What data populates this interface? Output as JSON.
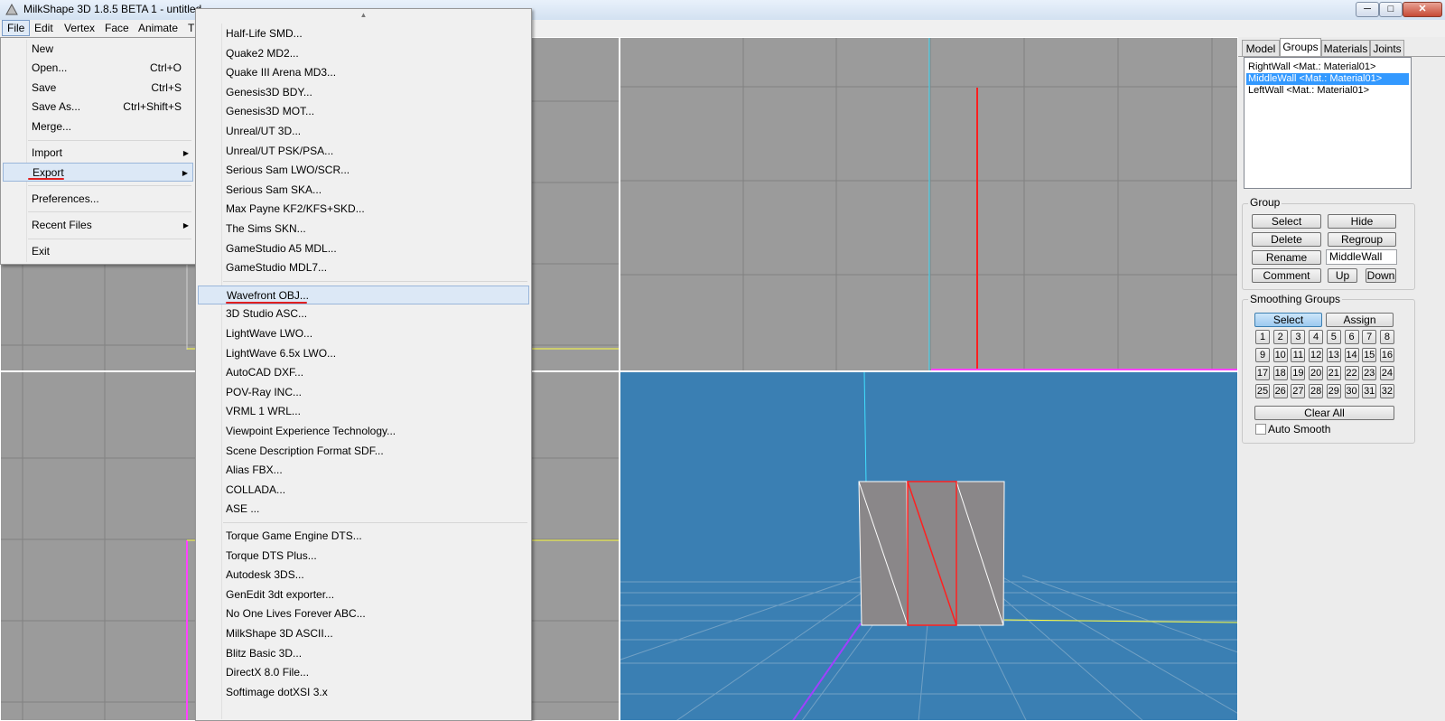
{
  "window": {
    "title": "MilkShape 3D 1.8.5 BETA 1 - untitled"
  },
  "window_controls": {
    "minimize": "─",
    "maximize": "□",
    "close": "✕"
  },
  "menubar": {
    "items": [
      "File",
      "Edit",
      "Vertex",
      "Face",
      "Animate",
      "T"
    ]
  },
  "file_menu": {
    "items": [
      {
        "label": "New",
        "shortcut": ""
      },
      {
        "label": "Open...",
        "shortcut": "Ctrl+O"
      },
      {
        "label": "Save",
        "shortcut": "Ctrl+S"
      },
      {
        "label": "Save As...",
        "shortcut": "Ctrl+Shift+S"
      },
      {
        "label": "Merge...",
        "shortcut": ""
      },
      {
        "label": "Import",
        "submenu": true
      },
      {
        "label": "Export",
        "submenu": true
      },
      {
        "label": "Preferences..."
      },
      {
        "label": "Recent Files",
        "submenu": true
      },
      {
        "label": "Exit"
      }
    ],
    "highlighted": "Export"
  },
  "export_menu": {
    "scroll_up": "▲",
    "items": [
      "Half-Life SMD...",
      "Quake2 MD2...",
      "Quake III Arena MD3...",
      "Genesis3D BDY...",
      "Genesis3D MOT...",
      "Unreal/UT 3D...",
      "Unreal/UT PSK/PSA...",
      "Serious Sam LWO/SCR...",
      "Serious Sam SKA...",
      "Max Payne KF2/KFS+SKD...",
      "The Sims SKN...",
      "GameStudio A5 MDL...",
      "GameStudio MDL7...",
      "Wavefront OBJ...",
      "3D Studio ASC...",
      "LightWave LWO...",
      "LightWave 6.5x LWO...",
      "AutoCAD DXF...",
      "POV-Ray INC...",
      "VRML 1 WRL...",
      "Viewpoint Experience Technology...",
      "Scene Description Format SDF...",
      "Alias FBX...",
      "COLLADA...",
      "ASE ...",
      "Torque Game Engine DTS...",
      "Torque DTS Plus...",
      "Autodesk 3DS...",
      "GenEdit 3dt exporter...",
      "No One Lives Forever ABC...",
      "MilkShape 3D ASCII...",
      "Blitz Basic 3D...",
      "DirectX 8.0 File...",
      "Softimage dotXSI 3.x"
    ],
    "highlighted": "Wavefront OBJ..."
  },
  "right_panel": {
    "tabs": [
      "Model",
      "Groups",
      "Materials",
      "Joints"
    ],
    "active_tab": "Groups",
    "groups": [
      "RightWall <Mat.: Material01>",
      "MiddleWall <Mat.: Material01>",
      "LeftWall <Mat.: Material01>"
    ],
    "selected_group": "MiddleWall <Mat.: Material01>",
    "group_section": {
      "legend": "Group",
      "select": "Select",
      "hide": "Hide",
      "delete": "Delete",
      "regroup": "Regroup",
      "rename": "Rename",
      "rename_value": "MiddleWall",
      "comment": "Comment",
      "up": "Up",
      "down": "Down"
    },
    "smoothing_section": {
      "legend": "Smoothing Groups",
      "select": "Select",
      "assign": "Assign",
      "numbers": [
        "1",
        "2",
        "3",
        "4",
        "5",
        "6",
        "7",
        "8",
        "9",
        "10",
        "11",
        "12",
        "13",
        "14",
        "15",
        "16",
        "17",
        "18",
        "19",
        "20",
        "21",
        "22",
        "23",
        "24",
        "25",
        "26",
        "27",
        "28",
        "29",
        "30",
        "31",
        "32"
      ],
      "clear_all": "Clear All",
      "auto_smooth": "Auto Smooth"
    }
  },
  "colors": {
    "viewport_gray": "#9b9b9b",
    "viewport_3d": "#3a7fb3",
    "selection": "#3399ff",
    "highlight_red": "#e02020"
  }
}
